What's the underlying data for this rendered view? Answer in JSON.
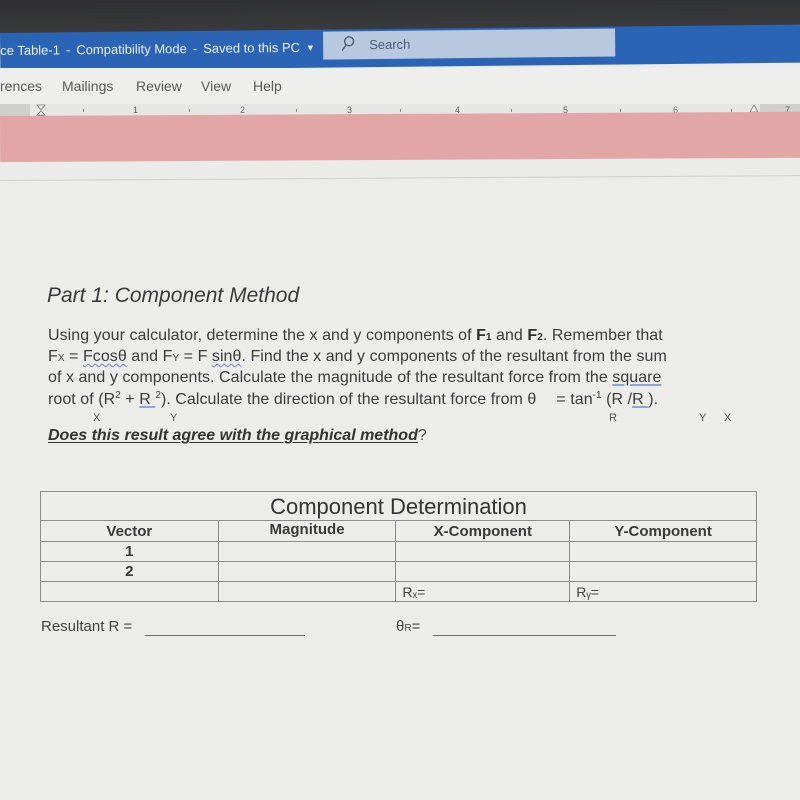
{
  "window": {
    "title_fragment": "ce Table-1",
    "mode": "Compatibility Mode",
    "save_status": "Saved to this PC",
    "separator": "-",
    "search_placeholder": "Search"
  },
  "ribbon": {
    "tabs": [
      {
        "label": "rences"
      },
      {
        "label": "Mailings"
      },
      {
        "label": "Review"
      },
      {
        "label": "View"
      },
      {
        "label": "Help"
      }
    ]
  },
  "ruler": {
    "numbers": [
      "1",
      "2",
      "3",
      "4",
      "5",
      "6",
      "7"
    ]
  },
  "document": {
    "part_title": "Part 1: Component Method",
    "paragraph": {
      "line1_a": "Using your calculator, determine the x and y components of ",
      "f1": "F",
      "f1_sub": "1",
      "line1_and": " and ",
      "f2": "F",
      "f2_sub": "2",
      "line1_b": ". Remember that",
      "line2_fx": "F",
      "line2_fx_sub": "X",
      "line2_eq1": " = ",
      "line2_fcos": "Fcosθ",
      "line2_and": " and F",
      "line2_fy_sub": "Y",
      "line2_eq2": " = F ",
      "line2_sin": "sinθ",
      "line2_rest": ". Find the x and y components of the resultant from the sum",
      "line3": "of x and y components. Calculate the magnitude of the resultant force from the ",
      "line3_square": "square",
      "line4_a": "root of (R",
      "line4_sup1": "2",
      "line4_plus": " + ",
      "line4_r2": "R ",
      "line4_sup2": "2",
      "line4_b": ").  Calculate the direction of the resultant force from θ",
      "line4_c": "= tan",
      "line4_sup3": "-1",
      "line4_d": " (R /",
      "line4_r": "R ",
      "line4_e": ").",
      "sub_x": "X",
      "sub_y": "Y",
      "sub_r": "R",
      "sub_y2": "Y",
      "sub_x2": "X"
    },
    "question_prefix": "Does this result agree with the graphical method",
    "question_mark": "?"
  },
  "table": {
    "caption": "Component Determination",
    "headers": [
      "Vector",
      "Magnitude",
      "X-Component",
      "Y-Component"
    ],
    "rows": [
      {
        "vector": "1",
        "magnitude": "",
        "x": "",
        "y": ""
      },
      {
        "vector": "2",
        "magnitude": "",
        "x": "",
        "y": ""
      },
      {
        "vector": "",
        "magnitude": "",
        "x": "Rₓ=",
        "y": "Rᵧ="
      }
    ]
  },
  "resultant": {
    "magnitude_label": "Resultant R =",
    "magnitude_value": "",
    "angle_label": "θ",
    "angle_sub": "R",
    "angle_eq": "=",
    "angle_value": ""
  },
  "colors": {
    "titlebar": "#2b63b5",
    "pink_band": "#e3a6a7",
    "spell_underline": "#7b7bd0"
  }
}
